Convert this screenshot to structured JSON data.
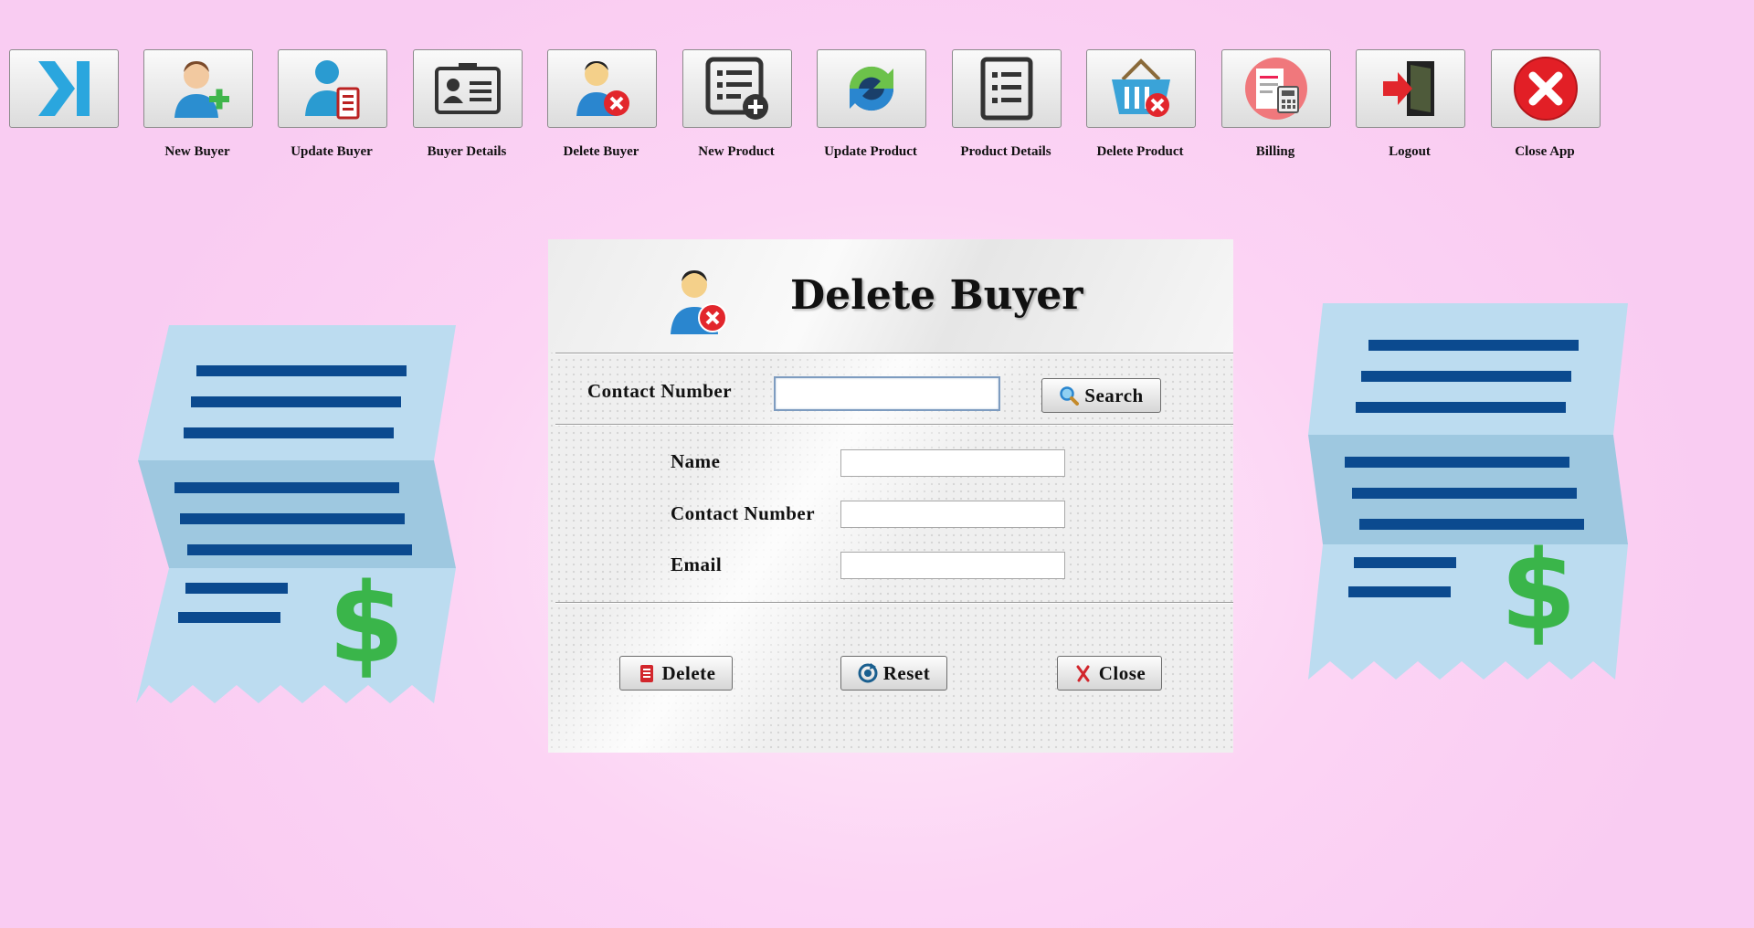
{
  "toolbar": {
    "items": [
      {
        "label": "",
        "icon": "collapse-arrow-icon"
      },
      {
        "label": "New Buyer",
        "icon": "add-user-icon"
      },
      {
        "label": "Update Buyer",
        "icon": "update-user-icon"
      },
      {
        "label": "Buyer Details",
        "icon": "id-card-icon"
      },
      {
        "label": "Delete Buyer",
        "icon": "delete-user-icon"
      },
      {
        "label": "New Product",
        "icon": "add-list-icon"
      },
      {
        "label": "Update Product",
        "icon": "refresh-icon"
      },
      {
        "label": "Product Details",
        "icon": "list-icon"
      },
      {
        "label": "Delete Product",
        "icon": "delete-basket-icon"
      },
      {
        "label": "Billing",
        "icon": "calculator-bill-icon"
      },
      {
        "label": "Logout",
        "icon": "logout-door-icon"
      },
      {
        "label": "Close App",
        "icon": "close-circle-icon"
      }
    ]
  },
  "form": {
    "title": "Delete Buyer",
    "search_label": "Contact Number",
    "search_value": "",
    "search_button": "Search",
    "name_label": "Name",
    "name_value": "",
    "contact_label": "Contact Number",
    "contact_value": "",
    "email_label": "Email",
    "email_value": "",
    "delete_button": "Delete",
    "reset_button": "Reset",
    "close_button": "Close"
  },
  "colors": {
    "background": "#fcd4f4",
    "receipt_paper": "#bcdcf0",
    "receipt_lines": "#0b4a8f",
    "dollar": "#3ab54a",
    "danger": "#e21f26"
  }
}
